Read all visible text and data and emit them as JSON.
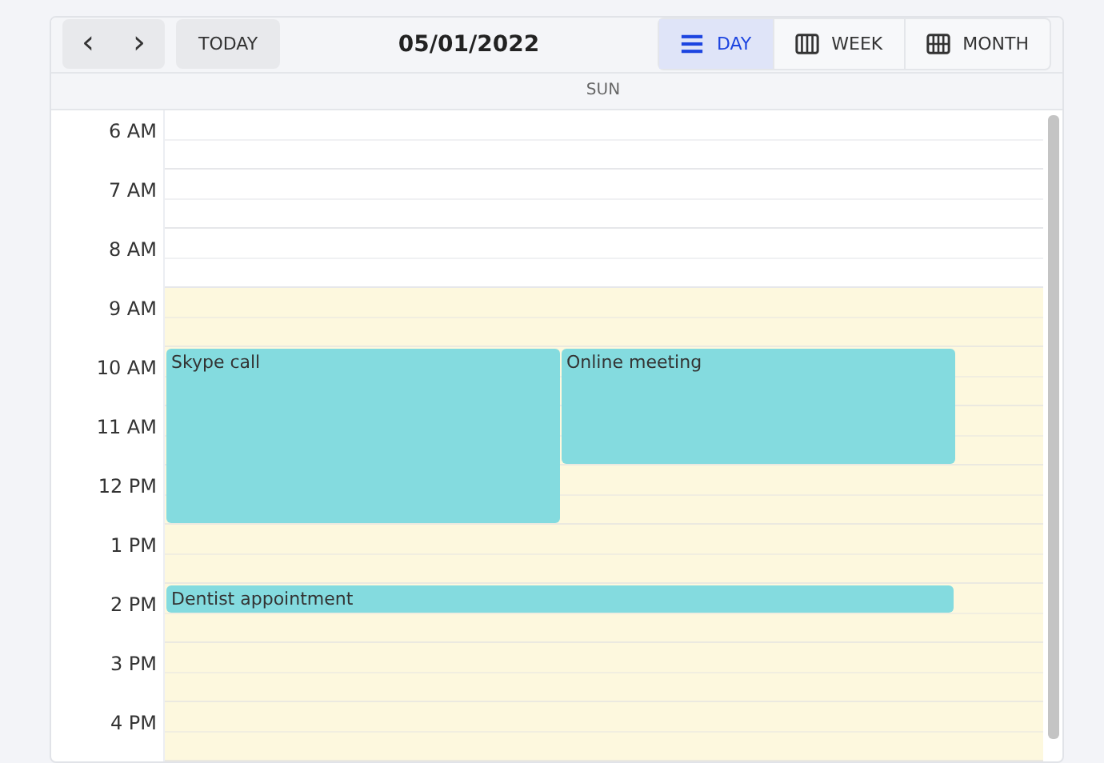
{
  "toolbar": {
    "prev": "‹",
    "next": "›",
    "today": "TODAY",
    "date": "05/01/2022",
    "views": [
      {
        "label": "DAY",
        "kind": "day",
        "selected": true
      },
      {
        "label": "WEEK",
        "kind": "week",
        "selected": false
      },
      {
        "label": "MONTH",
        "kind": "month",
        "selected": false
      }
    ]
  },
  "day_header": "SUN",
  "off_hours": [
    "6 AM",
    "7 AM",
    "8 AM"
  ],
  "working_hours": [
    "9 AM",
    "10 AM",
    "11 AM",
    "12 PM",
    "1 PM",
    "2 PM",
    "3 PM",
    "4 PM"
  ],
  "events": [
    {
      "title": "Skype call",
      "kind": "triple"
    },
    {
      "title": "Online meeting",
      "kind": "double"
    },
    {
      "title": "Dentist appointment",
      "kind": "half"
    }
  ]
}
